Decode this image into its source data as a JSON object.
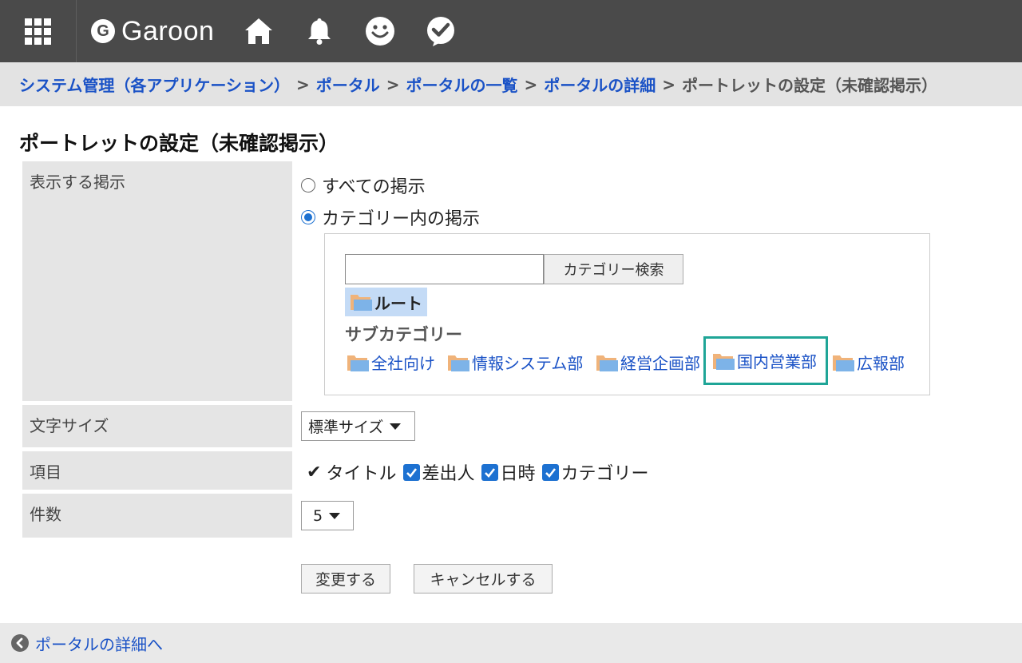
{
  "header": {
    "logo_letter": "G",
    "logo_text": "Garoon",
    "icons": [
      "app-menu-icon",
      "home-icon",
      "bell-icon",
      "smiley-icon",
      "check-bubble-icon"
    ]
  },
  "breadcrumb": {
    "items": [
      "システム管理（各アプリケーション）",
      "ポータル",
      "ポータルの一覧",
      "ポータルの詳細"
    ],
    "current": "ポートレットの設定（未確認掲示）",
    "separator": ">"
  },
  "page_title": "ポートレットの設定（未確認掲示）",
  "form": {
    "display": {
      "label": "表示する掲示",
      "option_all": "すべての掲示",
      "option_category": "カテゴリー内の掲示",
      "selected": "category",
      "search_value": "",
      "search_button": "カテゴリー検索",
      "root_label": "ルート",
      "subcategory_title": "サブカテゴリー",
      "subcategories": [
        "全社向け",
        "情報システム部",
        "経営企画部",
        "国内営業部",
        "広報部"
      ],
      "highlighted_subcategory": "国内営業部"
    },
    "font_size": {
      "label": "文字サイズ",
      "value": "標準サイズ"
    },
    "items": {
      "label": "項目",
      "fixed_item": "タイトル",
      "checked_items": [
        "差出人",
        "日時",
        "カテゴリー"
      ]
    },
    "count": {
      "label": "件数",
      "value": "5"
    }
  },
  "buttons": {
    "submit": "変更する",
    "cancel": "キャンセルする"
  },
  "footer": {
    "back_link": "ポータルの詳細へ"
  },
  "colors": {
    "header_bg": "#4a4a4a",
    "link": "#1a52c6",
    "checkbox": "#1d71d1",
    "highlight_outline": "#1fa597"
  }
}
